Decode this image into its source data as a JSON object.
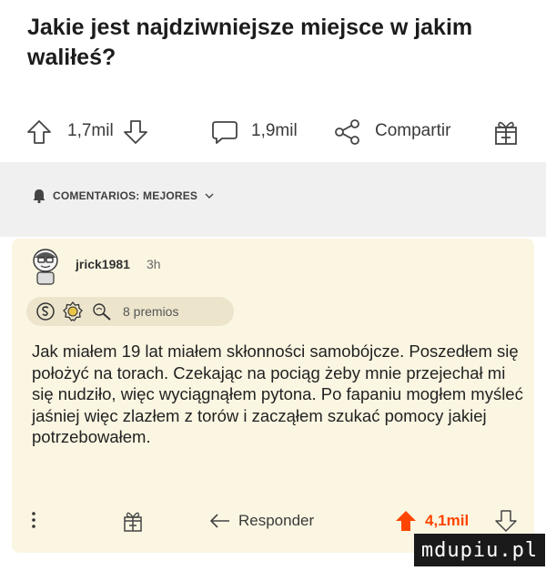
{
  "post": {
    "title": "Jakie jest najdziwniejsze miejsce w jakim waliłeś?"
  },
  "actions": {
    "votes": "1,7mil",
    "comments": "1,9mil",
    "share_label": "Compartir"
  },
  "sort": {
    "label": "COMENTARIOS: MEJORES"
  },
  "comment": {
    "username": "jrick1981",
    "time": "3h",
    "awards_label": "8 premios",
    "body": "Jak miałem 19 lat miałem skłonności samobójcze. Poszedłem się położyć na torach. Czekając na pociąg żeby mnie przejechał mi się nudziło, więc wyciągnąłem pytona. Po fapaniu mogłem myśleć jaśniej więc zlazłem z torów i zacząłem szukać pomocy jakiej potrzebowałem.",
    "reply_label": "Responder",
    "score": "4,1mil"
  },
  "watermark": "mdupiu.pl",
  "colors": {
    "upvote": "#ff4500",
    "card_bg": "#fbf6e2",
    "sort_bg": "#f0f0f1"
  }
}
